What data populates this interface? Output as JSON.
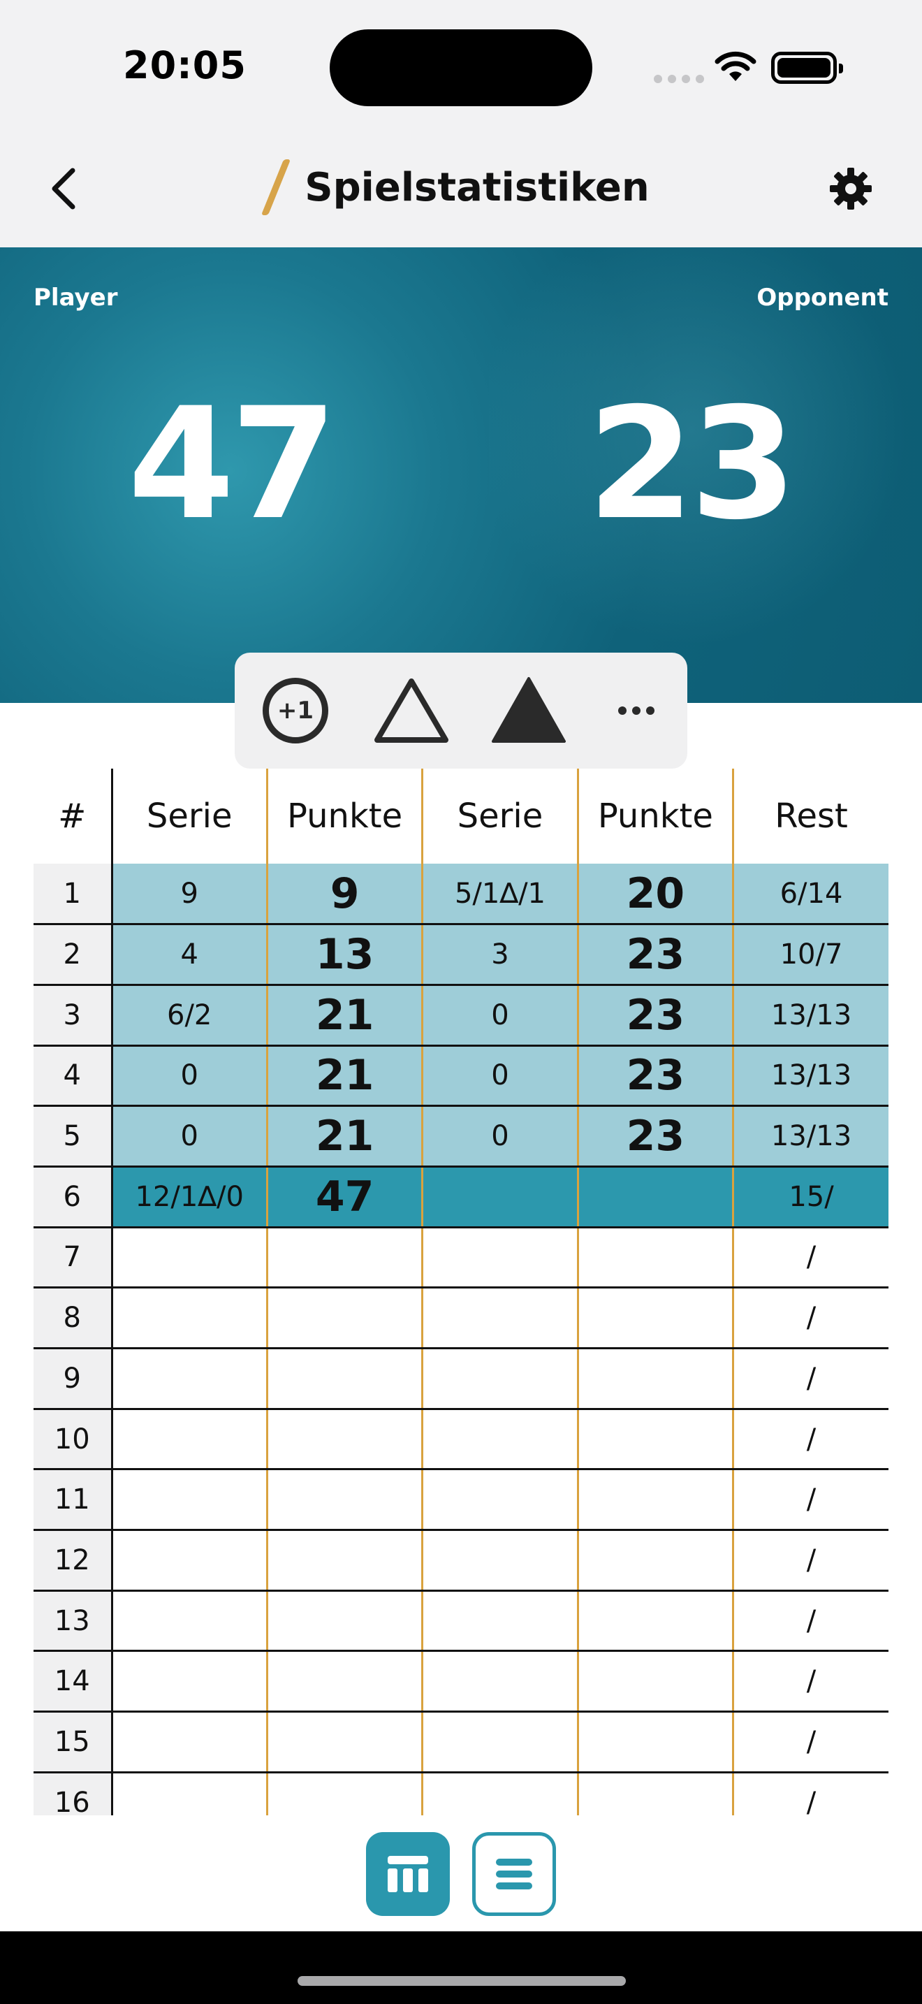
{
  "status_bar": {
    "time": "20:05"
  },
  "header": {
    "title": "Spielstatistiken",
    "back_icon": "chevron-left-icon",
    "settings_icon": "gear-icon"
  },
  "score": {
    "player_label": "Player",
    "opponent_label": "Opponent",
    "player_score": "47",
    "opponent_score": "23"
  },
  "actions": {
    "plus_one_label": "+1",
    "more_label": "•••"
  },
  "table": {
    "headers": [
      "#",
      "Serie",
      "Punkte",
      "Serie",
      "Punkte",
      "Rest"
    ],
    "rows": [
      {
        "num": "1",
        "serie1": "9",
        "punkte1": "9",
        "serie2": "5/1∆/1",
        "punkte2": "20",
        "rest": "6/14"
      },
      {
        "num": "2",
        "serie1": "4",
        "punkte1": "13",
        "serie2": "3",
        "punkte2": "23",
        "rest": "10/7"
      },
      {
        "num": "3",
        "serie1": "6/2",
        "punkte1": "21",
        "serie2": "0",
        "punkte2": "23",
        "rest": "13/13"
      },
      {
        "num": "4",
        "serie1": "0",
        "punkte1": "21",
        "serie2": "0",
        "punkte2": "23",
        "rest": "13/13"
      },
      {
        "num": "5",
        "serie1": "0",
        "punkte1": "21",
        "serie2": "0",
        "punkte2": "23",
        "rest": "13/13"
      },
      {
        "num": "6",
        "serie1": "12/1∆/0",
        "punkte1": "47",
        "serie2": "",
        "punkte2": "",
        "rest": "15/"
      },
      {
        "num": "7",
        "serie1": "",
        "punkte1": "",
        "serie2": "",
        "punkte2": "",
        "rest": "/"
      },
      {
        "num": "8",
        "serie1": "",
        "punkte1": "",
        "serie2": "",
        "punkte2": "",
        "rest": "/"
      },
      {
        "num": "9",
        "serie1": "",
        "punkte1": "",
        "serie2": "",
        "punkte2": "",
        "rest": "/"
      },
      {
        "num": "10",
        "serie1": "",
        "punkte1": "",
        "serie2": "",
        "punkte2": "",
        "rest": "/"
      },
      {
        "num": "11",
        "serie1": "",
        "punkte1": "",
        "serie2": "",
        "punkte2": "",
        "rest": "/"
      },
      {
        "num": "12",
        "serie1": "",
        "punkte1": "",
        "serie2": "",
        "punkte2": "",
        "rest": "/"
      },
      {
        "num": "13",
        "serie1": "",
        "punkte1": "",
        "serie2": "",
        "punkte2": "",
        "rest": "/"
      },
      {
        "num": "14",
        "serie1": "",
        "punkte1": "",
        "serie2": "",
        "punkte2": "",
        "rest": "/"
      },
      {
        "num": "15",
        "serie1": "",
        "punkte1": "",
        "serie2": "",
        "punkte2": "",
        "rest": "/"
      },
      {
        "num": "16",
        "serie1": "",
        "punkte1": "",
        "serie2": "",
        "punkte2": "",
        "rest": "/"
      }
    ]
  },
  "view_toggle": {
    "table_icon": "table-view-icon",
    "list_icon": "list-view-icon"
  },
  "colors": {
    "teal": "#2a97ad",
    "light_teal": "#9ecdd8",
    "panel_teal": "#0f627a",
    "gold_divider": "#d9a23e"
  }
}
